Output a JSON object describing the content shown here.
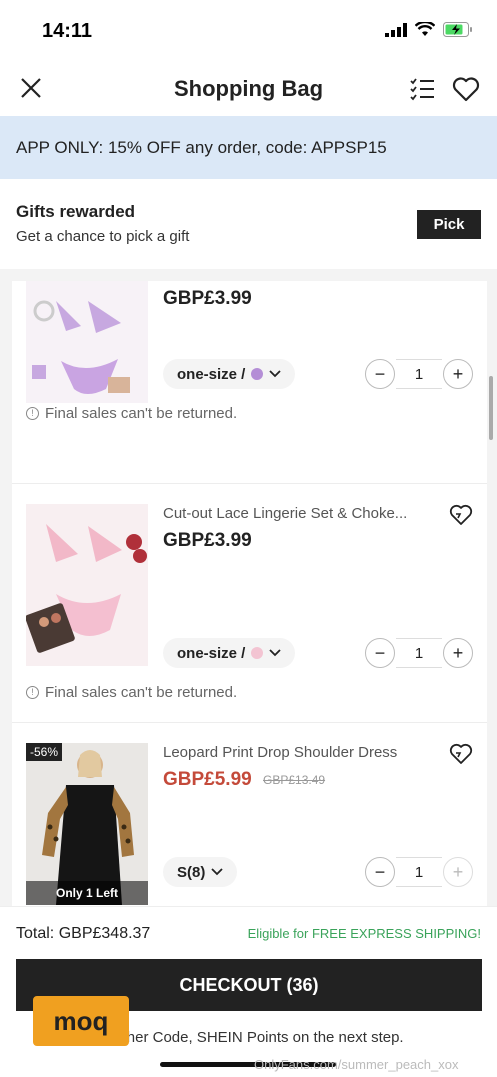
{
  "status": {
    "time": "14:11"
  },
  "nav": {
    "title": "Shopping Bag"
  },
  "promo": {
    "text": "APP ONLY: 15% OFF any order, code: APPSP15"
  },
  "gifts": {
    "title": "Gifts rewarded",
    "subtitle": "Get a chance to pick a gift",
    "pick_label": "Pick"
  },
  "items": [
    {
      "name": "",
      "price": "GBP£3.99",
      "size_label": "one-size /",
      "swatch_color": "#b48ed6",
      "quantity": "1",
      "note": "Final sales can't be returned."
    },
    {
      "name": "Cut-out Lace Lingerie Set & Choke...",
      "price": "GBP£3.99",
      "size_label": "one-size /",
      "swatch_color": "#f3c4d2",
      "quantity": "1",
      "note": "Final sales can't be returned."
    },
    {
      "name": "Leopard Print Drop Shoulder Dress",
      "price": "GBP£5.99",
      "old_price": "GBP£13.49",
      "discount": "-56%",
      "stock": "Only 1 Left",
      "size_label": "S(8)",
      "quantity": "1"
    }
  ],
  "footer": {
    "total_label": "Total:",
    "total_value": "GBP£348.37",
    "express": "Eligible for FREE EXPRESS SHIPPING!",
    "checkout_label": "CHECKOUT (36)",
    "voucher_note": "Voucher Code, SHEIN Points on the next step."
  },
  "watermark": {
    "logo_text": "moq",
    "text": "OnlyFans.com/summer_peach_xox"
  },
  "colors": {
    "promo_bg": "#dbe8f7",
    "sale_price": "#c44a3a",
    "express_green": "#3aa35a",
    "checkout_bg": "#222222"
  }
}
